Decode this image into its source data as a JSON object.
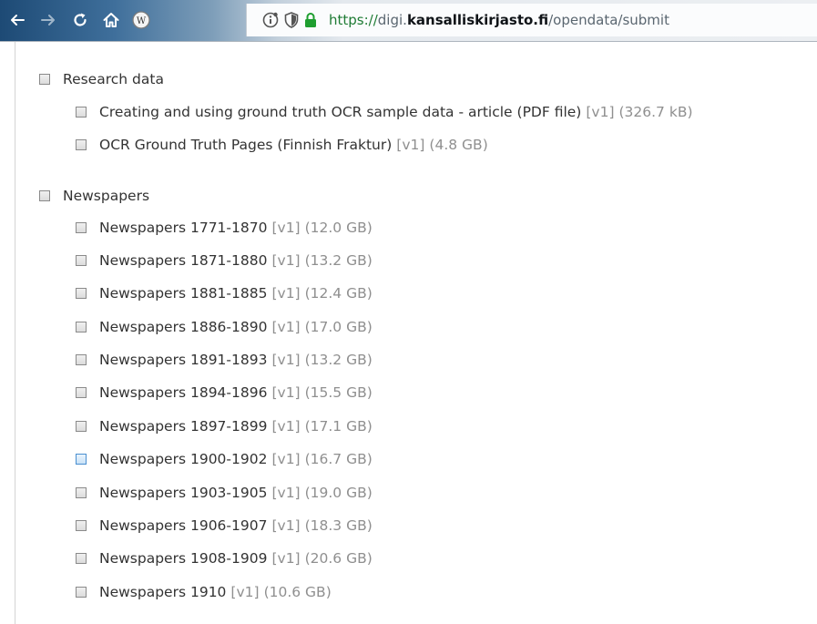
{
  "browser": {
    "url": {
      "scheme": "https://",
      "subdomain": "digi.",
      "domain": "kansalliskirjasto.fi",
      "path": "/opendata/submit"
    },
    "icons": [
      "back-arrow-icon",
      "forward-arrow-icon",
      "reload-icon",
      "home-icon",
      "wikipedia-icon",
      "site-info-icon",
      "tracking-shield-icon",
      "lock-icon"
    ]
  },
  "groups": [
    {
      "label": "Research data",
      "items": [
        {
          "label": "Creating and using ground truth OCR sample data - article (PDF file)",
          "version": "[v1]",
          "size": "(326.7 kB)"
        },
        {
          "label": "OCR Ground Truth Pages (Finnish Fraktur)",
          "version": "[v1]",
          "size": "(4.8 GB)"
        }
      ]
    },
    {
      "label": "Newspapers",
      "items": [
        {
          "label": "Newspapers 1771-1870",
          "version": "[v1]",
          "size": "(12.0 GB)"
        },
        {
          "label": "Newspapers 1871-1880",
          "version": "[v1]",
          "size": "(13.2 GB)"
        },
        {
          "label": "Newspapers 1881-1885",
          "version": "[v1]",
          "size": "(12.4 GB)"
        },
        {
          "label": "Newspapers 1886-1890",
          "version": "[v1]",
          "size": "(17.0 GB)"
        },
        {
          "label": "Newspapers 1891-1893",
          "version": "[v1]",
          "size": "(13.2 GB)"
        },
        {
          "label": "Newspapers 1894-1896",
          "version": "[v1]",
          "size": "(15.5 GB)"
        },
        {
          "label": "Newspapers 1897-1899",
          "version": "[v1]",
          "size": "(17.1 GB)"
        },
        {
          "label": "Newspapers 1900-1902",
          "version": "[v1]",
          "size": "(16.7 GB)"
        },
        {
          "label": "Newspapers 1903-1905",
          "version": "[v1]",
          "size": "(19.0 GB)"
        },
        {
          "label": "Newspapers 1906-1907",
          "version": "[v1]",
          "size": "(18.3 GB)"
        },
        {
          "label": "Newspapers 1908-1909",
          "version": "[v1]",
          "size": "(20.6 GB)"
        },
        {
          "label": "Newspapers 1910",
          "version": "[v1]",
          "size": "(10.6 GB)"
        }
      ]
    }
  ],
  "colors": {
    "label": "#333333",
    "meta": "#8f8f8f",
    "hover_checkbox": "#c8e1f7"
  }
}
